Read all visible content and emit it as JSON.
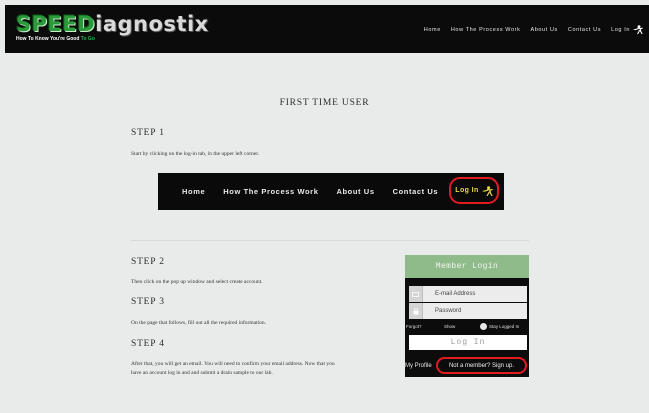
{
  "header": {
    "logo": {
      "part1": "SPEED",
      "part2": "iagnostix",
      "tagline_main": "How To Know You're Good ",
      "tagline_accent": "To Go"
    },
    "nav": [
      "Home",
      "How The Process Work",
      "About Us",
      "Contact Us"
    ],
    "login_label": "Log In"
  },
  "main": {
    "title": "FIRST TIME USER",
    "step1": {
      "heading": "STEP 1",
      "text": "Start by clicking on the log-in tab, in the upper left corner."
    },
    "nav_screenshot": {
      "items": [
        "Home",
        "How The Process Work",
        "About Us",
        "Contact Us"
      ],
      "login_label": "Log In",
      "highlight_color": "#e11b22",
      "login_text_color": "#e8d84a"
    },
    "step2": {
      "heading": "STEP 2",
      "text": "Then click on the pop up window and select create account."
    },
    "step3": {
      "heading": "STEP 3",
      "text": "On the page that follows, fill out all the required information."
    },
    "step4": {
      "heading": "STEP 4",
      "text_line1": "After that, you will get an email. You will need to confirm your email address. Now that you",
      "text_line2": "have an account log in and and submit a drain sample to our lab."
    },
    "member_login": {
      "title": "Member Login",
      "email_placeholder": "E-mail Address",
      "password_placeholder": "Password",
      "forgot": "Forgot?",
      "show": "Show",
      "stay_logged_in": "Stay Logged In",
      "login_button": "Log In",
      "my_profile": "My Profile",
      "signup": "Not a member? Sign up.",
      "header_color": "#8fbb8a"
    }
  }
}
